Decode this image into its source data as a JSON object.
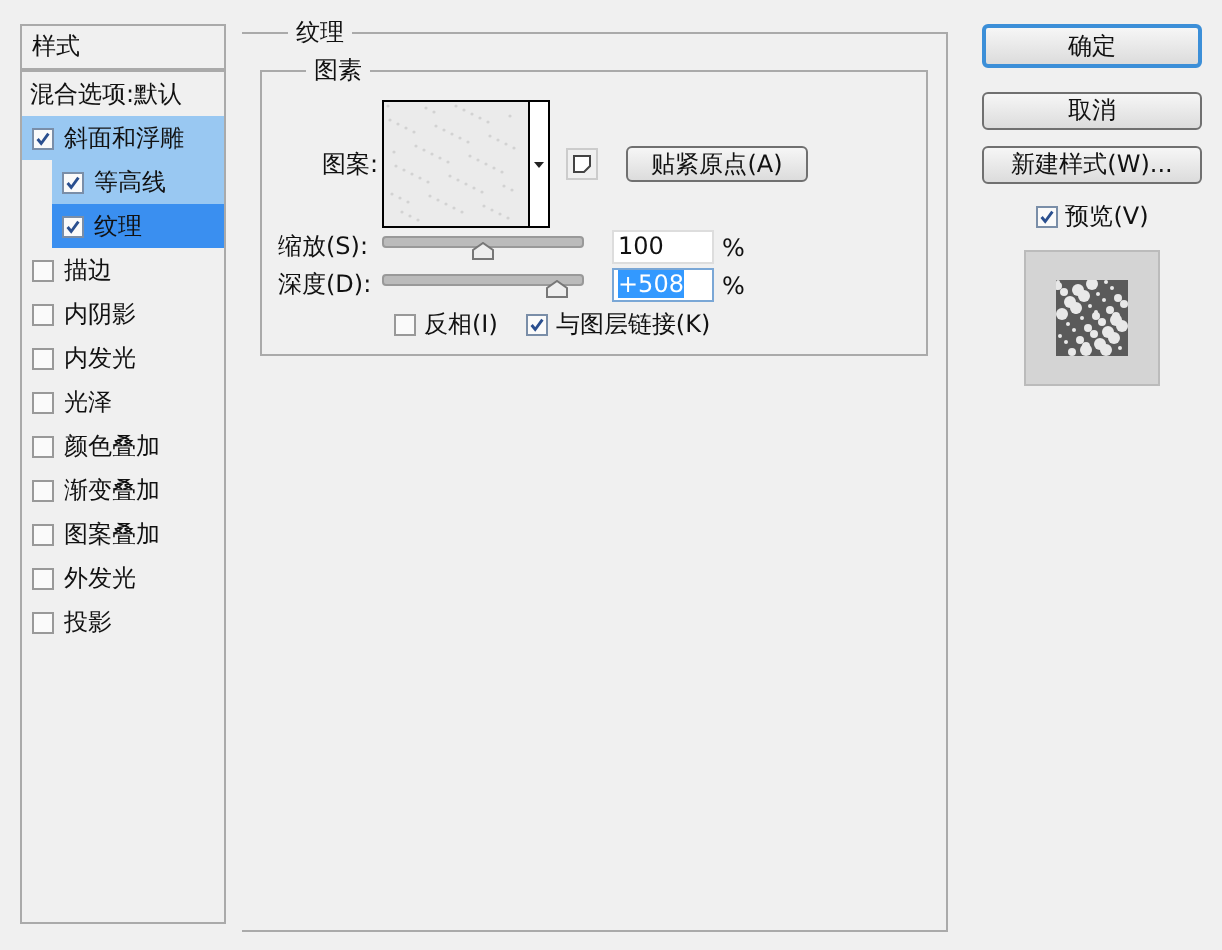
{
  "styles_panel": {
    "header": "样式",
    "blending_options": "混合选项:默认",
    "items": [
      {
        "label": "斜面和浮雕",
        "checked": true,
        "selected": false,
        "children": [
          {
            "label": "等高线",
            "checked": true,
            "selected": false
          },
          {
            "label": "纹理",
            "checked": true,
            "selected": true
          }
        ]
      },
      {
        "label": "描边",
        "checked": false,
        "selected": false
      },
      {
        "label": "内阴影",
        "checked": false,
        "selected": false
      },
      {
        "label": "内发光",
        "checked": false,
        "selected": false
      },
      {
        "label": "光泽",
        "checked": false,
        "selected": false
      },
      {
        "label": "颜色叠加",
        "checked": false,
        "selected": false
      },
      {
        "label": "渐变叠加",
        "checked": false,
        "selected": false
      },
      {
        "label": "图案叠加",
        "checked": false,
        "selected": false
      },
      {
        "label": "外发光",
        "checked": false,
        "selected": false
      },
      {
        "label": "投影",
        "checked": false,
        "selected": false
      }
    ]
  },
  "texture": {
    "title": "纹理",
    "group": "图素",
    "pattern_label": "图案:",
    "snap_button": "贴紧原点(A)",
    "sliders": [
      {
        "label": "缩放(S):",
        "level": 0.5,
        "value": "100",
        "unit": "%",
        "selected": false
      },
      {
        "label": "深度(D):",
        "level": 0.87,
        "value": "+508",
        "unit": "%",
        "selected": true
      }
    ],
    "options": [
      {
        "label": "反相(I)",
        "checked": false
      },
      {
        "label": "与图层链接(K)",
        "checked": true
      }
    ]
  },
  "buttons": [
    {
      "label": "确定",
      "default": true
    },
    {
      "label": "取消",
      "default": false
    },
    {
      "label": "新建样式(W)...",
      "default": false
    }
  ],
  "preview": {
    "label": "预览(V)",
    "checked": true
  }
}
